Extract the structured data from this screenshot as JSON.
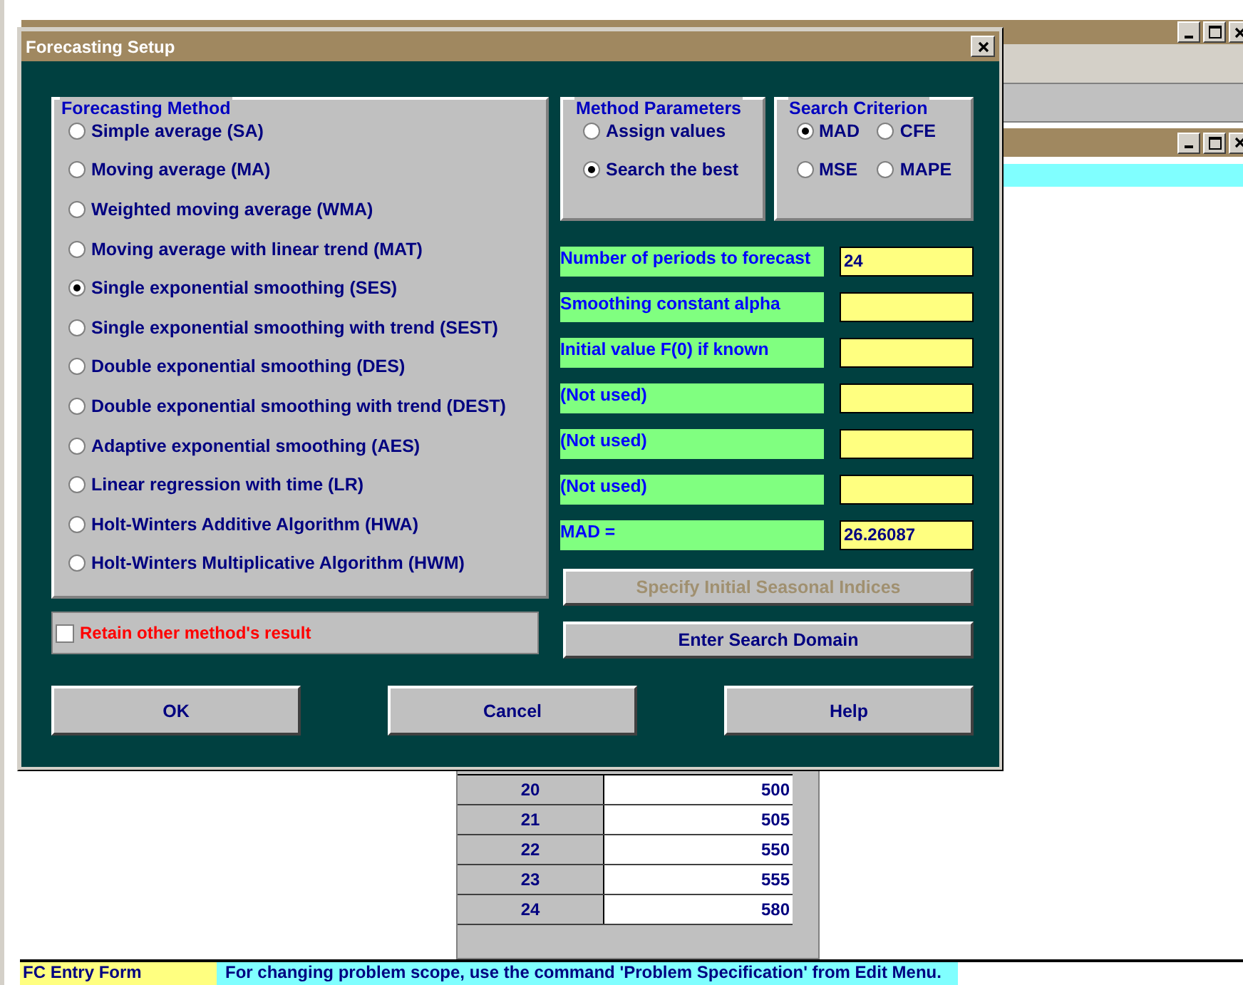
{
  "dialog": {
    "title": "Forecasting Setup",
    "method_group": {
      "title": "Forecasting Method",
      "options": [
        {
          "label": "Simple average (SA)",
          "selected": false
        },
        {
          "label": "Moving average (MA)",
          "selected": false
        },
        {
          "label": "Weighted moving average (WMA)",
          "selected": false
        },
        {
          "label": "Moving average with linear trend (MAT)",
          "selected": false
        },
        {
          "label": "Single exponential smoothing (SES)",
          "selected": true
        },
        {
          "label": "Single exponential smoothing with trend (SEST)",
          "selected": false
        },
        {
          "label": "Double exponential smoothing (DES)",
          "selected": false
        },
        {
          "label": "Double exponential smoothing with trend (DEST)",
          "selected": false
        },
        {
          "label": "Adaptive exponential smoothing (AES)",
          "selected": false
        },
        {
          "label": "Linear regression with time (LR)",
          "selected": false
        },
        {
          "label": "Holt-Winters Additive Algorithm (HWA)",
          "selected": false
        },
        {
          "label": "Holt-Winters Multiplicative Algorithm (HWM)",
          "selected": false
        }
      ]
    },
    "parameters_group": {
      "title": "Method Parameters",
      "options": [
        {
          "label": "Assign values",
          "selected": false
        },
        {
          "label": "Search the best",
          "selected": true
        }
      ]
    },
    "criterion_group": {
      "title": "Search Criterion",
      "options": [
        {
          "label": "MAD",
          "selected": true
        },
        {
          "label": "CFE",
          "selected": false
        },
        {
          "label": "MSE",
          "selected": false
        },
        {
          "label": "MAPE",
          "selected": false
        }
      ]
    },
    "fields": [
      {
        "label": "Number of periods to forecast",
        "value": "24"
      },
      {
        "label": "Smoothing constant alpha"
      },
      {
        "label": "Initial value F(0) if known"
      },
      {
        "label": "(Not used)"
      },
      {
        "label": "(Not used)"
      },
      {
        "label": "(Not used)"
      },
      {
        "label": "MAD =",
        "value": "26.26087"
      }
    ],
    "side_buttons": [
      {
        "label": "Specify Initial Seasonal Indices",
        "disabled": true
      },
      {
        "label": "Enter Search Domain",
        "disabled": false
      }
    ],
    "retain_checkbox": {
      "label": "Retain other method's result",
      "checked": false
    },
    "buttons": [
      "OK",
      "Cancel",
      "Help"
    ]
  },
  "table": {
    "rows": [
      {
        "period": "20",
        "value": "500"
      },
      {
        "period": "21",
        "value": "505"
      },
      {
        "period": "22",
        "value": "550"
      },
      {
        "period": "23",
        "value": "555"
      },
      {
        "period": "24",
        "value": "580"
      }
    ]
  },
  "status_bar": {
    "form": "FC Entry Form",
    "message": "For changing problem scope, use the command 'Problem Specification' from Edit Menu."
  }
}
